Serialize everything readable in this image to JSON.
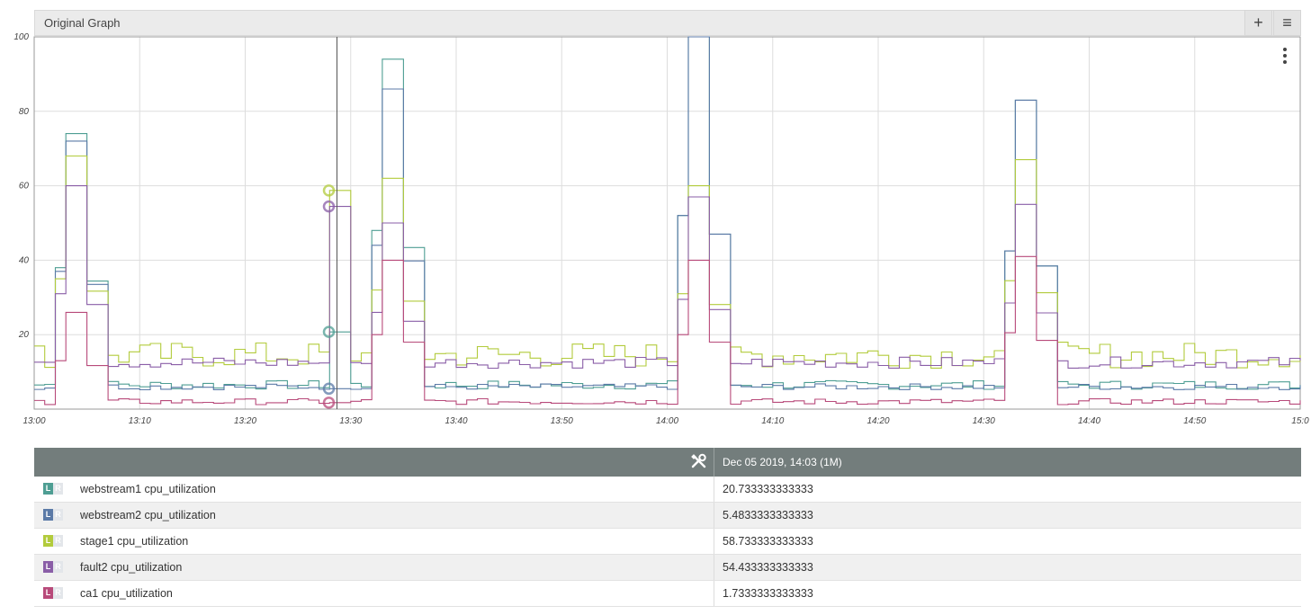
{
  "header": {
    "title": "Original Graph",
    "add_icon": "plus-icon",
    "menu_icon": "hamburger-icon"
  },
  "chart_data": {
    "type": "line",
    "step": true,
    "ylim": [
      0,
      100
    ],
    "yticks": [
      20,
      40,
      60,
      80,
      100
    ],
    "xlim": [
      0,
      60
    ],
    "xtick_labels": [
      "13:00",
      "13:10",
      "13:20",
      "13:30",
      "13:40",
      "13:50",
      "14:00",
      "14:10",
      "14:20",
      "14:30",
      "14:40",
      "14:50",
      "15:0"
    ],
    "grid": true,
    "cursor_x": 14.35,
    "series": [
      {
        "name": "webstream1 cpu_utilization",
        "color": "#4e9e93",
        "cursor_value": 20.733333333333
      },
      {
        "name": "webstream2 cpu_utilization",
        "color": "#5b7aa7",
        "cursor_value": 5.4833333333333
      },
      {
        "name": "stage1 cpu_utilization",
        "color": "#b2cb3c",
        "cursor_value": 58.733333333333
      },
      {
        "name": "fault2 cpu_utilization",
        "color": "#8a5ea7",
        "cursor_value": 54.433333333333
      },
      {
        "name": "ca1 cpu_utilization",
        "color": "#b84a7a",
        "cursor_value": 1.7333333333333
      }
    ]
  },
  "table": {
    "header_icon": "wrench-screwdriver-icon",
    "timestamp": "Dec 05 2019, 14:03  (1M)",
    "l_label": "L",
    "r_label": "R",
    "rows": [
      {
        "name": "webstream1 cpu_utilization",
        "value": "20.733333333333",
        "color": "#4e9e93"
      },
      {
        "name": "webstream2 cpu_utilization",
        "value": "5.4833333333333",
        "color": "#5b7aa7"
      },
      {
        "name": "stage1 cpu_utilization",
        "value": "58.733333333333",
        "color": "#b2cb3c"
      },
      {
        "name": "fault2 cpu_utilization",
        "value": "54.433333333333",
        "color": "#8a5ea7"
      },
      {
        "name": "ca1 cpu_utilization",
        "value": "1.7333333333333",
        "color": "#b84a7a"
      }
    ]
  }
}
